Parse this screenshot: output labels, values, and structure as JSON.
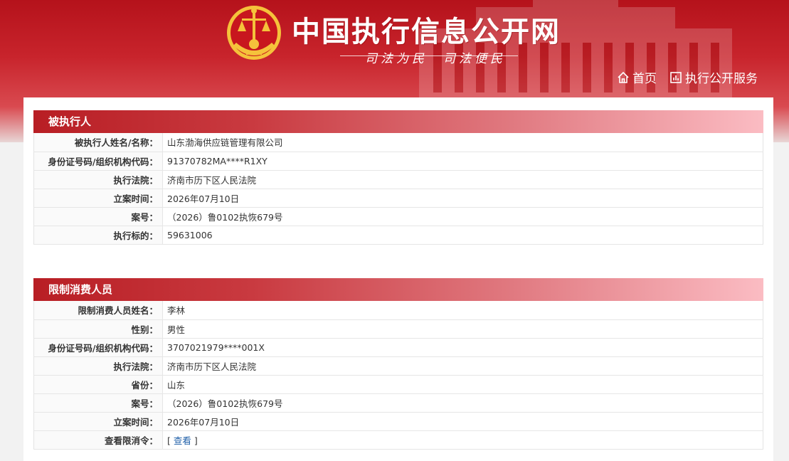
{
  "header": {
    "site_title": "中国执行信息公开网",
    "slogan": "司法为民　司法便民",
    "nav": [
      {
        "label": "首页",
        "icon": "home-icon"
      },
      {
        "label": "执行公开服务",
        "icon": "chart-icon"
      }
    ]
  },
  "colors": {
    "header_red": "#c8242c",
    "section_red": "#b81e24",
    "link_blue": "#1f5fa8"
  },
  "sections": [
    {
      "title": "被执行人",
      "rows": [
        {
          "label": "被执行人姓名/名称：",
          "value": "山东渤海供应链管理有限公司"
        },
        {
          "label": "身份证号码/组织机构代码：",
          "value": "91370782MA****R1XY"
        },
        {
          "label": "执行法院：",
          "value": "济南市历下区人民法院"
        },
        {
          "label": "立案时间：",
          "value": "2026年07月10日"
        },
        {
          "label": "案号：",
          "value": "（2026）鲁0102执恢679号"
        },
        {
          "label": "执行标的：",
          "value": "59631006"
        }
      ]
    },
    {
      "title": "限制消费人员",
      "rows": [
        {
          "label": "限制消费人员姓名：",
          "value": "李林"
        },
        {
          "label": "性别：",
          "value": "男性"
        },
        {
          "label": "身份证号码/组织机构代码：",
          "value": "3707021979****001X"
        },
        {
          "label": "执行法院：",
          "value": "济南市历下区人民法院"
        },
        {
          "label": "省份：",
          "value": "山东"
        },
        {
          "label": "案号：",
          "value": "（2026）鲁0102执恢679号"
        },
        {
          "label": "立案时间：",
          "value": "2026年07月10日"
        },
        {
          "label": "查看限消令：",
          "value_prefix": "[ ",
          "link": "查看",
          "value_suffix": " ]"
        }
      ]
    }
  ]
}
